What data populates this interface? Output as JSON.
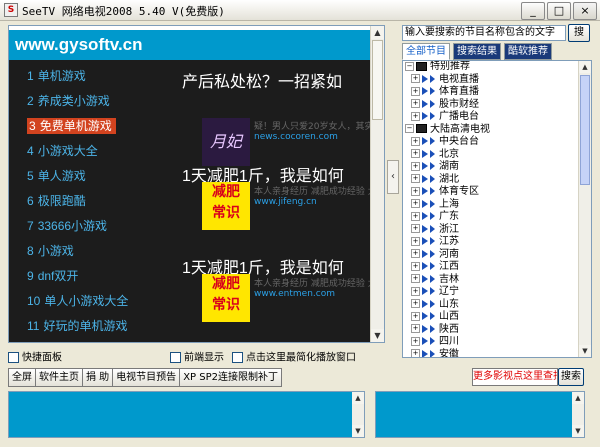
{
  "window": {
    "title": "SeeTV 网络电视2008 5.40 V(免费版)",
    "minimize_label": "_",
    "maximize_label": "□",
    "close_label": "×"
  },
  "webpage": {
    "site_header": "www.gysoftv.cn",
    "game_list": [
      {
        "num": "1",
        "label": "单机游戏"
      },
      {
        "num": "2",
        "label": "养成类小游戏"
      },
      {
        "num": "3",
        "label": "免费单机游戏",
        "selected": true
      },
      {
        "num": "4",
        "label": "小游戏大全"
      },
      {
        "num": "5",
        "label": "单人游戏"
      },
      {
        "num": "6",
        "label": "极限跑酷"
      },
      {
        "num": "7",
        "label": "33666小游戏"
      },
      {
        "num": "8",
        "label": "小游戏"
      },
      {
        "num": "9",
        "label": "dnf双开"
      },
      {
        "num": "10",
        "label": "单人小游戏大全"
      },
      {
        "num": "11",
        "label": "好玩的单机游戏"
      }
    ],
    "ads": [
      {
        "headline": "产后私处松？一招紧如",
        "sub": "疑！男人只爱20岁女人，其实是",
        "url": "news.cocoren.com",
        "thumb": "月妃"
      },
      {
        "headline": "1天减肥1斤，我是如何",
        "sub": "本人亲身经历 减肥成功经验 大",
        "url": "www.jifeng.cn",
        "thumb_l1": "减肥",
        "thumb_l2": "常识"
      },
      {
        "headline": "1天减肥1斤，我是如何",
        "sub": "本人亲身经历 减肥成功经验 大",
        "url": "www.entmen.com",
        "thumb_l1": "减肥",
        "thumb_l2": "常识"
      }
    ]
  },
  "right_panel": {
    "search_placeholder": "输入要搜索的节目名称包含的文字",
    "search_button": "搜",
    "tabs": [
      "全部节目",
      "搜索结果",
      "酷软推荐"
    ],
    "tree": [
      {
        "level": 0,
        "type": "film",
        "label": "特别推荐"
      },
      {
        "level": 1,
        "label": "电视直播"
      },
      {
        "level": 1,
        "label": "体育直播"
      },
      {
        "level": 1,
        "label": "股市财经"
      },
      {
        "level": 1,
        "label": "广播电台"
      },
      {
        "level": 0,
        "type": "film",
        "label": "大陆高清电视"
      },
      {
        "level": 1,
        "label": "中央台台"
      },
      {
        "level": 1,
        "label": "北京"
      },
      {
        "level": 1,
        "label": "湖南"
      },
      {
        "level": 1,
        "label": "湖北"
      },
      {
        "level": 1,
        "label": "体育专区"
      },
      {
        "level": 1,
        "label": "上海"
      },
      {
        "level": 1,
        "label": "广东"
      },
      {
        "level": 1,
        "label": "浙江"
      },
      {
        "level": 1,
        "label": "江苏"
      },
      {
        "level": 1,
        "label": "河南"
      },
      {
        "level": 1,
        "label": "江西"
      },
      {
        "level": 1,
        "label": "吉林"
      },
      {
        "level": 1,
        "label": "辽宁"
      },
      {
        "level": 1,
        "label": "山东"
      },
      {
        "level": 1,
        "label": "山西"
      },
      {
        "level": 1,
        "label": "陕西"
      },
      {
        "level": 1,
        "label": "四川"
      },
      {
        "level": 1,
        "label": "安徽"
      }
    ]
  },
  "options": {
    "quick_panel": "快捷面板",
    "front_display": "前端显示",
    "minimize_hint": "点击这里最简化播放窗口"
  },
  "toolbar": {
    "buttons": [
      "全屏",
      "软件主页",
      "捐 助",
      "电视节目预告",
      "XP SP2连接限制补丁"
    ],
    "more_link": "更多影视点这里查找",
    "search_button": "搜索"
  },
  "icons": {
    "app": "tv-app-icon",
    "folder": "film-strip-icon",
    "channel": "play-arrow-icon"
  },
  "colors": {
    "accent": "#0099cc",
    "selected_item_bg": "#d2431f",
    "link_red": "#e00000"
  }
}
